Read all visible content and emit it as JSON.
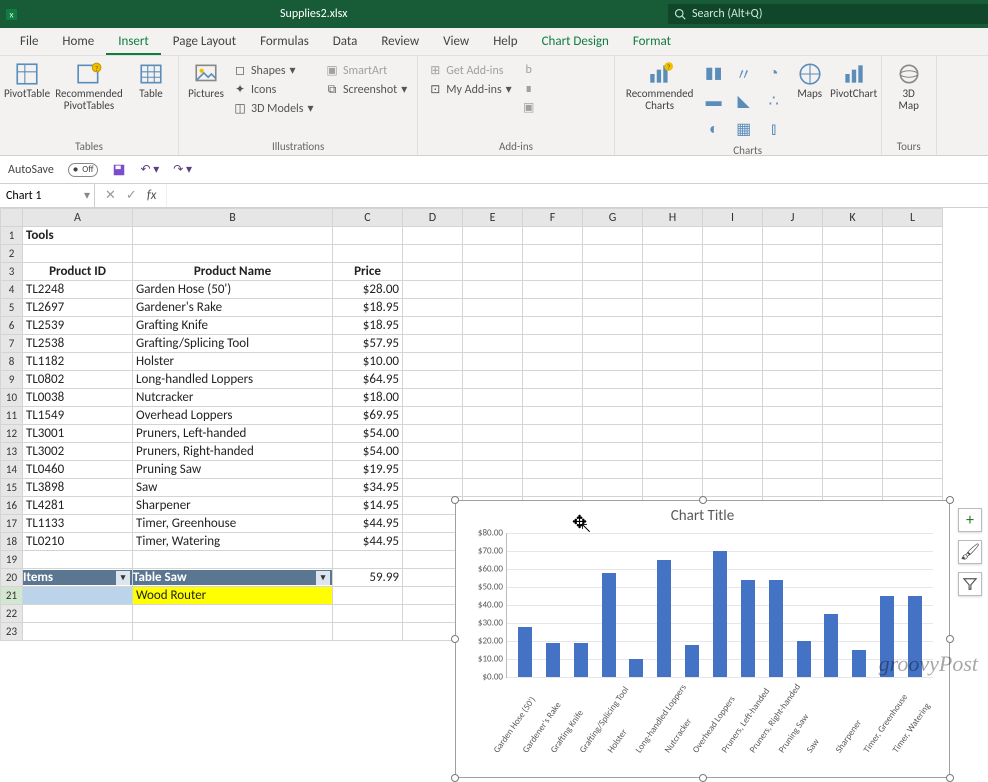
{
  "titlebar": {
    "filename": "Supplies2.xlsx",
    "search_placeholder": "Search (Alt+Q)"
  },
  "tabs": {
    "file": "File",
    "home": "Home",
    "insert": "Insert",
    "pagelayout": "Page Layout",
    "formulas": "Formulas",
    "data": "Data",
    "review": "Review",
    "view": "View",
    "help": "Help",
    "chartdesign": "Chart Design",
    "format": "Format"
  },
  "ribbon": {
    "tables": {
      "pivottable": "PivotTable",
      "recommended": "Recommended\nPivotTables",
      "table": "Table",
      "label": "Tables"
    },
    "illustrations": {
      "pictures": "Pictures",
      "shapes": "Shapes",
      "icons": "Icons",
      "models": "3D Models",
      "smartart": "SmartArt",
      "screenshot": "Screenshot",
      "label": "Illustrations"
    },
    "addins": {
      "get": "Get Add-ins",
      "my": "My Add-ins",
      "label": "Add-ins"
    },
    "charts": {
      "recommended": "Recommended\nCharts",
      "maps": "Maps",
      "pivotchart": "PivotChart",
      "label": "Charts"
    },
    "tours": {
      "map": "3D\nMap",
      "label": "Tours"
    }
  },
  "qat": {
    "autosave": "AutoSave",
    "autosave_state": "Off"
  },
  "fx": {
    "namebox": "Chart 1",
    "fx_symbol": "fx"
  },
  "columns": [
    "A",
    "B",
    "C",
    "D",
    "E",
    "F",
    "G",
    "H",
    "I",
    "J",
    "K",
    "L"
  ],
  "sheet": {
    "a1": "Tools",
    "headers": {
      "a": "Product ID",
      "b": "Product Name",
      "c": "Price"
    },
    "rows": [
      {
        "id": "TL2248",
        "name": "Garden Hose (50')",
        "price": "$28.00"
      },
      {
        "id": "TL2697",
        "name": "Gardener's Rake",
        "price": "$18.95"
      },
      {
        "id": "TL2539",
        "name": "Grafting Knife",
        "price": "$18.95"
      },
      {
        "id": "TL2538",
        "name": "Grafting/Splicing Tool",
        "price": "$57.95"
      },
      {
        "id": "TL1182",
        "name": "Holster",
        "price": "$10.00"
      },
      {
        "id": "TL0802",
        "name": "Long-handled Loppers",
        "price": "$64.95"
      },
      {
        "id": "TL0038",
        "name": "Nutcracker",
        "price": "$18.00"
      },
      {
        "id": "TL1549",
        "name": "Overhead Loppers",
        "price": "$69.95"
      },
      {
        "id": "TL3001",
        "name": "Pruners, Left-handed",
        "price": "$54.00"
      },
      {
        "id": "TL3002",
        "name": "Pruners, Right-handed",
        "price": "$54.00"
      },
      {
        "id": "TL0460",
        "name": "Pruning Saw",
        "price": "$19.95"
      },
      {
        "id": "TL3898",
        "name": "Saw",
        "price": "$34.95"
      },
      {
        "id": "TL4281",
        "name": "Sharpener",
        "price": "$14.95"
      },
      {
        "id": "TL1133",
        "name": "Timer, Greenhouse",
        "price": "$44.95"
      },
      {
        "id": "TL0210",
        "name": "Timer, Watering",
        "price": "$44.95"
      }
    ],
    "row20": {
      "a": "Items",
      "b": "Table Saw",
      "c": "59.99"
    },
    "row21": {
      "b": "Wood Router"
    }
  },
  "chart_side": {
    "plus": "+",
    "brush": "✎",
    "funnel": "▿"
  },
  "chart_data": {
    "type": "bar",
    "title": "Chart Title",
    "ylabel": "",
    "xlabel": "",
    "ylim": [
      0,
      80
    ],
    "yticks": [
      "$0.00",
      "$10.00",
      "$20.00",
      "$30.00",
      "$40.00",
      "$50.00",
      "$60.00",
      "$70.00",
      "$80.00"
    ],
    "categories": [
      "Garden Hose (50')",
      "Gardener's Rake",
      "Grafting Knife",
      "Grafting/Splicing Tool",
      "Holster",
      "Long-handled Loppers",
      "Nutcracker",
      "Overhead Loppers",
      "Pruners, Left-handed",
      "Pruners, Right-handed",
      "Pruning Saw",
      "Saw",
      "Sharpener",
      "Timer, Greenhouse",
      "Timer, Watering"
    ],
    "values": [
      28.0,
      18.95,
      18.95,
      57.95,
      10.0,
      64.95,
      18.0,
      69.95,
      54.0,
      54.0,
      19.95,
      34.95,
      14.95,
      44.95,
      44.95
    ]
  },
  "watermark": "groovyPost"
}
